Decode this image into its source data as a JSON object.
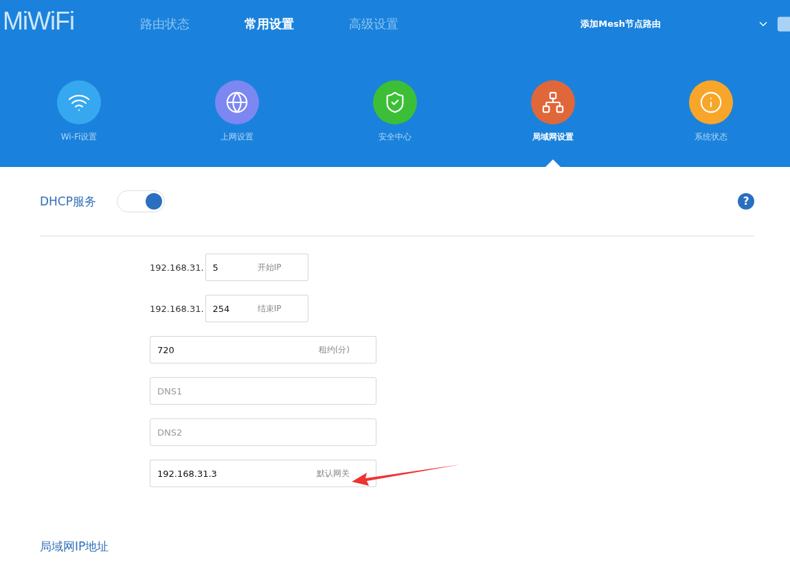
{
  "logo": "MiWiFi",
  "tabs": [
    {
      "label": "路由状态",
      "selected": false
    },
    {
      "label": "常用设置",
      "selected": true
    },
    {
      "label": "高级设置",
      "selected": false
    }
  ],
  "mesh_link": "添加Mesh节点路由",
  "nav_items": [
    {
      "label": "Wi-Fi设置",
      "color": "#35a8f0",
      "selected": false
    },
    {
      "label": "上网设置",
      "color": "#7c87f2",
      "selected": false
    },
    {
      "label": "安全中心",
      "color": "#3cbf36",
      "selected": false
    },
    {
      "label": "局域网设置",
      "color": "#e0673a",
      "selected": true
    },
    {
      "label": "系统状态",
      "color": "#f8a62a",
      "selected": false
    }
  ],
  "dhcp": {
    "title": "DHCP服务",
    "on": true,
    "help": "?",
    "fields": [
      {
        "kind": "prefixed",
        "prefix": "192.168.31.",
        "value": "5",
        "suffix": "开始IP"
      },
      {
        "kind": "prefixed",
        "prefix": "192.168.31.",
        "value": "254",
        "suffix": "结束IP"
      },
      {
        "kind": "full",
        "value": "720",
        "suffix": "租约(分)"
      },
      {
        "kind": "full",
        "placeholder": "DNS1"
      },
      {
        "kind": "full",
        "placeholder": "DNS2"
      },
      {
        "kind": "full",
        "value": "192.168.31.3",
        "suffix": "默认网关"
      }
    ]
  },
  "lan_ip": {
    "title": "局域网IP地址"
  }
}
